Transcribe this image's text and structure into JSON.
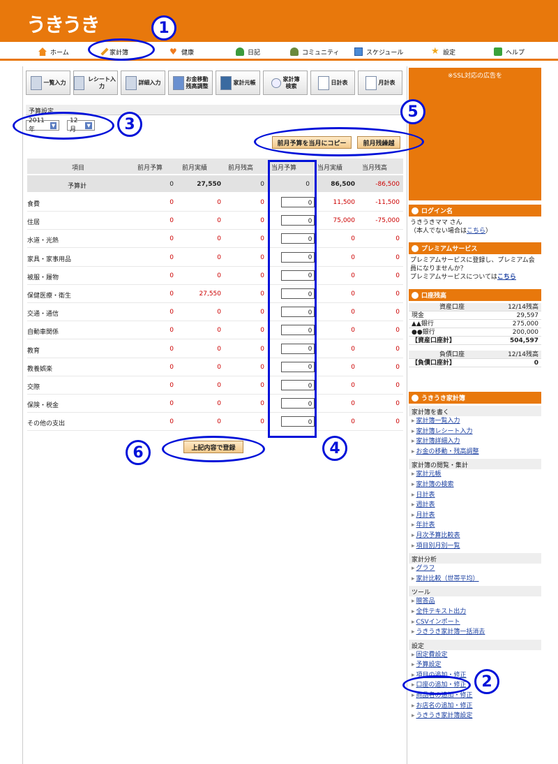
{
  "app": {
    "logo": "うきうき"
  },
  "nav": [
    {
      "label": "ホーム",
      "icon": "home-icon"
    },
    {
      "label": "家計簿",
      "icon": "pencil-icon"
    },
    {
      "label": "健康",
      "icon": "heart-icon"
    },
    {
      "label": "日記",
      "icon": "person-icon"
    },
    {
      "label": "コミュニティ",
      "icon": "people-icon"
    },
    {
      "label": "スケジュール",
      "icon": "calendar-icon"
    },
    {
      "label": "設定",
      "icon": "star-icon"
    },
    {
      "label": "ヘルプ",
      "icon": "help-icon"
    }
  ],
  "toolbar": [
    {
      "label": "一覧入力"
    },
    {
      "label": "レシート入力"
    },
    {
      "label": "詳細入力"
    },
    {
      "label": "お金移動\n残高調整"
    },
    {
      "label": "家計元帳"
    },
    {
      "label": "家計簿\n検索"
    },
    {
      "label": "日計表"
    },
    {
      "label": "月計表"
    }
  ],
  "budget": {
    "section_title": "予算設定",
    "year": "2011年",
    "month": "12月",
    "copy_button": "前月予算を当月にコピー",
    "carry_button": "前月残繰越",
    "submit_button": "上記内容で登録"
  },
  "table": {
    "headers": [
      "項目",
      "前月予算",
      "前月実績",
      "前月残高",
      "当月予算",
      "当月実績",
      "当月残高"
    ],
    "total": {
      "name": "予算計",
      "prev_budget": "0",
      "prev_actual": "27,550",
      "prev_balance": "0",
      "cur_budget": "0",
      "cur_actual": "86,500",
      "cur_balance": "-86,500"
    },
    "rows": [
      {
        "name": "食費",
        "prev_budget": "0",
        "prev_actual": "0",
        "prev_balance": "0",
        "cur_budget": "0",
        "cur_actual": "11,500",
        "cur_balance": "-11,500"
      },
      {
        "name": "住居",
        "prev_budget": "0",
        "prev_actual": "0",
        "prev_balance": "0",
        "cur_budget": "0",
        "cur_actual": "75,000",
        "cur_balance": "-75,000"
      },
      {
        "name": "水道・光熱",
        "prev_budget": "0",
        "prev_actual": "0",
        "prev_balance": "0",
        "cur_budget": "0",
        "cur_actual": "0",
        "cur_balance": "0"
      },
      {
        "name": "家具・家事用品",
        "prev_budget": "0",
        "prev_actual": "0",
        "prev_balance": "0",
        "cur_budget": "0",
        "cur_actual": "0",
        "cur_balance": "0"
      },
      {
        "name": "被服・履物",
        "prev_budget": "0",
        "prev_actual": "0",
        "prev_balance": "0",
        "cur_budget": "0",
        "cur_actual": "0",
        "cur_balance": "0"
      },
      {
        "name": "保健医療・衛生",
        "prev_budget": "0",
        "prev_actual": "27,550",
        "prev_balance": "0",
        "cur_budget": "0",
        "cur_actual": "0",
        "cur_balance": "0"
      },
      {
        "name": "交通・通信",
        "prev_budget": "0",
        "prev_actual": "0",
        "prev_balance": "0",
        "cur_budget": "0",
        "cur_actual": "0",
        "cur_balance": "0"
      },
      {
        "name": "自動車関係",
        "prev_budget": "0",
        "prev_actual": "0",
        "prev_balance": "0",
        "cur_budget": "0",
        "cur_actual": "0",
        "cur_balance": "0"
      },
      {
        "name": "教育",
        "prev_budget": "0",
        "prev_actual": "0",
        "prev_balance": "0",
        "cur_budget": "0",
        "cur_actual": "0",
        "cur_balance": "0"
      },
      {
        "name": "教養娯楽",
        "prev_budget": "0",
        "prev_actual": "0",
        "prev_balance": "0",
        "cur_budget": "0",
        "cur_actual": "0",
        "cur_balance": "0"
      },
      {
        "name": "交際",
        "prev_budget": "0",
        "prev_actual": "0",
        "prev_balance": "0",
        "cur_budget": "0",
        "cur_actual": "0",
        "cur_balance": "0"
      },
      {
        "name": "保険・税金",
        "prev_budget": "0",
        "prev_actual": "0",
        "prev_balance": "0",
        "cur_budget": "0",
        "cur_actual": "0",
        "cur_balance": "0"
      },
      {
        "name": "その他の支出",
        "prev_budget": "0",
        "prev_actual": "0",
        "prev_balance": "0",
        "cur_budget": "0",
        "cur_actual": "0",
        "cur_balance": "0"
      }
    ]
  },
  "sidebar": {
    "ad": "※SSL対応の広告を",
    "login": {
      "title": "ログイン名",
      "user": "うきうきママ さん",
      "note": "（本人でない場合は",
      "link": "こちら",
      "close": "）"
    },
    "premium": {
      "title": "プレミアムサービス",
      "text": "プレミアムサービスに登録し、プレミアム会員になりませんか？",
      "text2": "プレミアムサービスについては",
      "link": "こちら"
    },
    "accounts": {
      "title": "口座残高",
      "asset_header": "資産口座",
      "asset_date": "12/14残高",
      "assets": [
        {
          "name": "現金",
          "value": "29,597"
        },
        {
          "name": "▲▲銀行",
          "value": "275,000"
        },
        {
          "name": "●●銀行",
          "value": "200,000"
        }
      ],
      "asset_total_label": "【資産口座計】",
      "asset_total": "504,597",
      "debt_header": "負債口座",
      "debt_date": "12/14残高",
      "debt_total_label": "【負債口座計】",
      "debt_total": "0"
    },
    "menu_title": "うきうき家計簿",
    "groups": [
      {
        "title": "家計簿を書く",
        "links": [
          "家計簿一覧入力",
          "家計簿レシート入力",
          "家計簿詳細入力",
          "お金の移動・残高調整"
        ]
      },
      {
        "title": "家計簿の閲覧・集計",
        "links": [
          "家計元帳",
          "家計簿の検索",
          "日計表",
          "週計表",
          "月計表",
          "年計表",
          "月次予算比較表",
          "項目別月別一覧"
        ]
      },
      {
        "title": "家計分析",
        "links": [
          "グラフ",
          "家計比較（世帯平均）"
        ]
      },
      {
        "title": "ツール",
        "links": [
          "贈答品",
          "全件テキスト出力",
          "CSVインポート",
          "うきうき家計簿一括消去"
        ]
      },
      {
        "title": "設定",
        "links": [
          "固定費設定",
          "予算設定",
          "項目の追加・修正",
          "口座の追加・修正",
          "商品名の追加・修正",
          "お店名の追加・修正",
          "うきうき家計簿設定"
        ]
      }
    ]
  },
  "annotations": [
    "1",
    "2",
    "3",
    "4",
    "5",
    "6"
  ]
}
